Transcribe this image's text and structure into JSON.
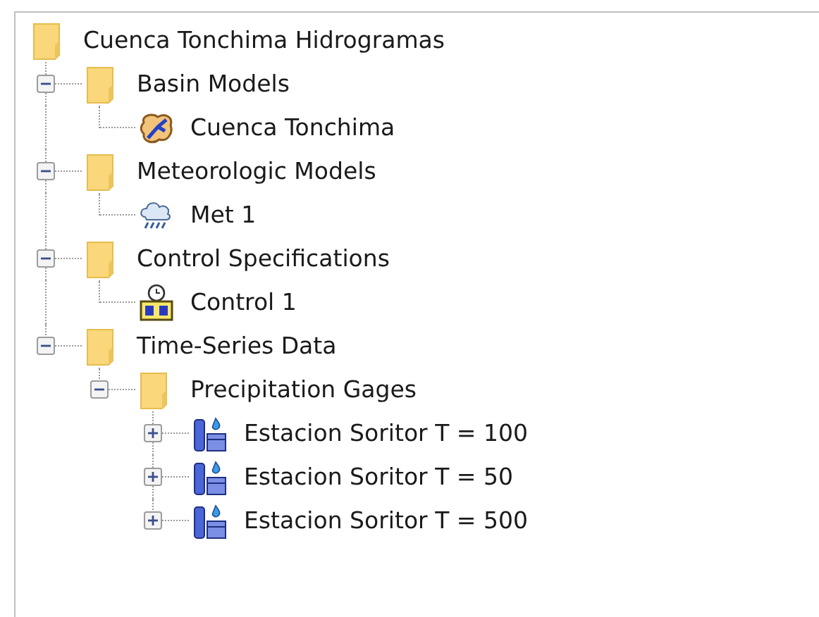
{
  "tree": {
    "label": "Cuenca Tonchima Hidrogramas",
    "kind": "folder",
    "children": [
      {
        "label": "Basin Models",
        "kind": "folder",
        "expanded": true,
        "children": [
          {
            "label": "Cuenca Tonchima",
            "kind": "basin"
          }
        ]
      },
      {
        "label": "Meteorologic Models",
        "kind": "folder",
        "expanded": true,
        "children": [
          {
            "label": "Met 1",
            "kind": "met"
          }
        ]
      },
      {
        "label": "Control Specifications",
        "kind": "folder",
        "expanded": true,
        "children": [
          {
            "label": "Control 1",
            "kind": "control"
          }
        ]
      },
      {
        "label": "Time-Series Data",
        "kind": "folder",
        "expanded": true,
        "children": [
          {
            "label": "Precipitation Gages",
            "kind": "folder",
            "expanded": true,
            "children": [
              {
                "label": "Estacion Soritor T = 100",
                "kind": "gage",
                "expanded": false
              },
              {
                "label": "Estacion Soritor T = 50",
                "kind": "gage",
                "expanded": false
              },
              {
                "label": "Estacion Soritor T = 500",
                "kind": "gage",
                "expanded": false
              }
            ]
          }
        ]
      }
    ]
  }
}
